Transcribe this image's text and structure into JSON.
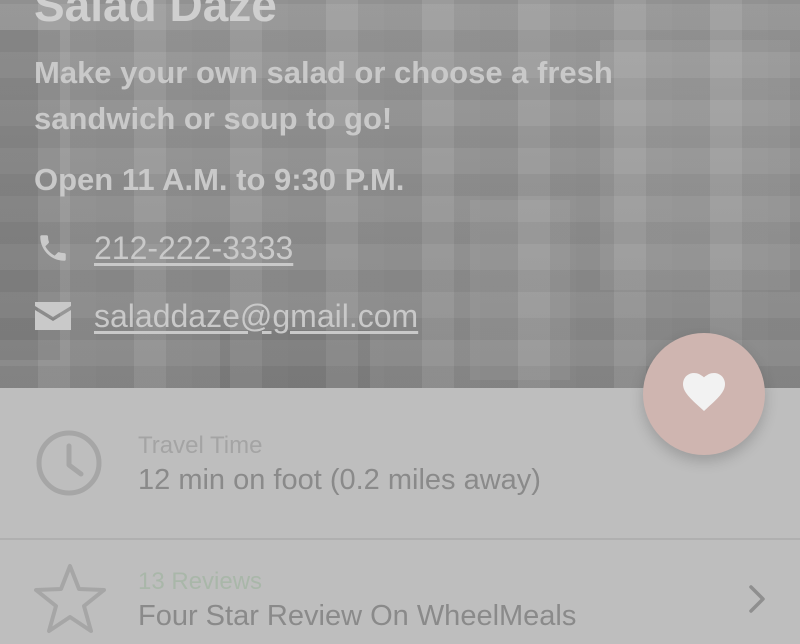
{
  "restaurant": {
    "name": "Salad Daze",
    "description": "Make your own salad or choose a fresh sandwich or soup to go!",
    "hours": "Open 11 A.M. to 9:30 P.M.",
    "phone": "212-222-3333",
    "email": "saladdaze@gmail.com"
  },
  "travel": {
    "label": "Travel Time",
    "value": "12 min on foot (0.2 miles away)",
    "icon": "clock-icon"
  },
  "reviews": {
    "label": "13 Reviews",
    "value": "Four Star Review On WheelMeals",
    "icon": "star-outline-icon"
  },
  "fab": {
    "icon": "heart-icon"
  },
  "colors": {
    "hero_text": "#c9c9c9",
    "fab_background": "#cfb5b0",
    "reviews_label": "#a9b7a9",
    "scrim": "#bdbdbd"
  }
}
